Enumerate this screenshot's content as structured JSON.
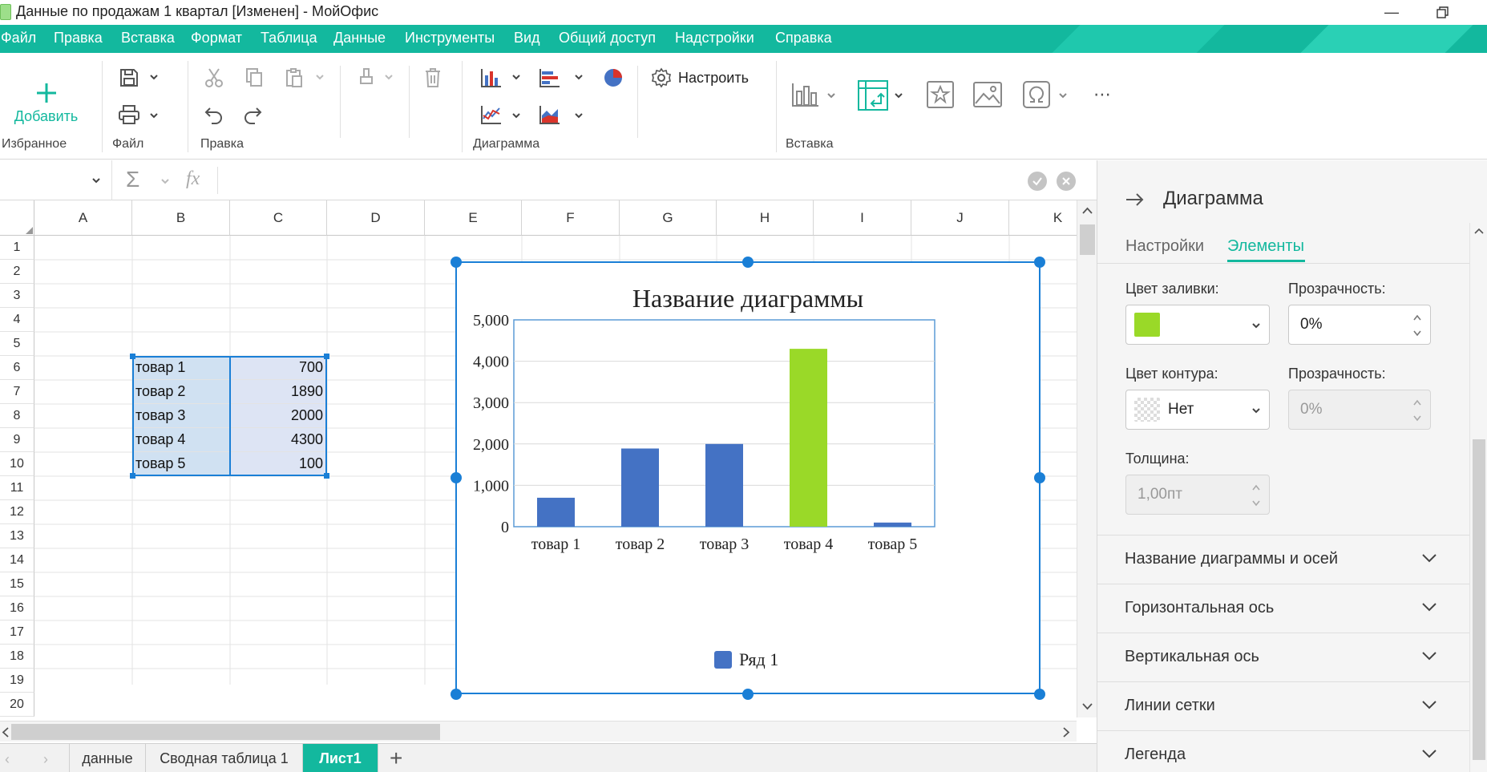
{
  "window": {
    "title": "Данные по продажам 1 квартал [Изменен] - МойОфис"
  },
  "menu": [
    "Файл",
    "Правка",
    "Вставка",
    "Формат",
    "Таблица",
    "Данные",
    "Инструменты",
    "Вид",
    "Общий доступ",
    "Надстройки",
    "Справка"
  ],
  "ribbon": {
    "add_label": "Добавить",
    "groups": {
      "favorites": "Избранное",
      "file": "Файл",
      "edit": "Правка",
      "chart": "Диаграмма",
      "insert": "Вставка"
    },
    "configure_label": "Настроить"
  },
  "formula": {
    "fx": "fx",
    "sigma": "Σ"
  },
  "grid": {
    "columns": [
      "A",
      "B",
      "C",
      "D",
      "E",
      "F",
      "G",
      "H",
      "I",
      "J",
      "K"
    ],
    "rows": [
      "1",
      "2",
      "3",
      "4",
      "5",
      "6",
      "7",
      "8",
      "9",
      "10",
      "11",
      "12",
      "13",
      "14",
      "15",
      "16",
      "17",
      "18",
      "19",
      "20"
    ],
    "data": [
      {
        "name": "товар 1",
        "value": "700"
      },
      {
        "name": "товар 2",
        "value": "1890"
      },
      {
        "name": "товар 3",
        "value": "2000"
      },
      {
        "name": "товар 4",
        "value": "4300"
      },
      {
        "name": "товар 5",
        "value": "100"
      }
    ]
  },
  "chart_data": {
    "type": "bar",
    "title": "Название диаграммы",
    "categories": [
      "товар 1",
      "товар 2",
      "товар 3",
      "товар 4",
      "товар 5"
    ],
    "series": [
      {
        "name": "Ряд 1",
        "values": [
          700,
          1890,
          2000,
          4300,
          100
        ],
        "color": "#4472c4"
      }
    ],
    "highlight_index": 3,
    "highlight_color": "#9ad928",
    "ylim": [
      0,
      5000
    ],
    "yticks": [
      "0",
      "1,000",
      "2,000",
      "3,000",
      "4,000",
      "5,000"
    ],
    "grid": true,
    "legend": "bottom"
  },
  "panel": {
    "title": "Диаграмма",
    "tabs": [
      "Настройки",
      "Элементы"
    ],
    "active_tab": "Элементы",
    "fill_color_label": "Цвет заливки:",
    "fill_color": "#9ad928",
    "transparency_label": "Прозрачность:",
    "fill_transparency": "0%",
    "outline_color_label": "Цвет контура:",
    "outline_value": "Нет",
    "outline_transparency": "0%",
    "thickness_label": "Толщина:",
    "thickness_value": "1,00пт",
    "sections": [
      "Название диаграммы и осей",
      "Горизонтальная ось",
      "Вертикальная ось",
      "Линии сетки",
      "Легенда"
    ]
  },
  "sheets": {
    "tabs": [
      "данные",
      "Сводная таблица 1",
      "Лист1"
    ],
    "active": "Лист1"
  },
  "colors": {
    "accent": "#13b89e",
    "selection": "#1a7fd6"
  }
}
